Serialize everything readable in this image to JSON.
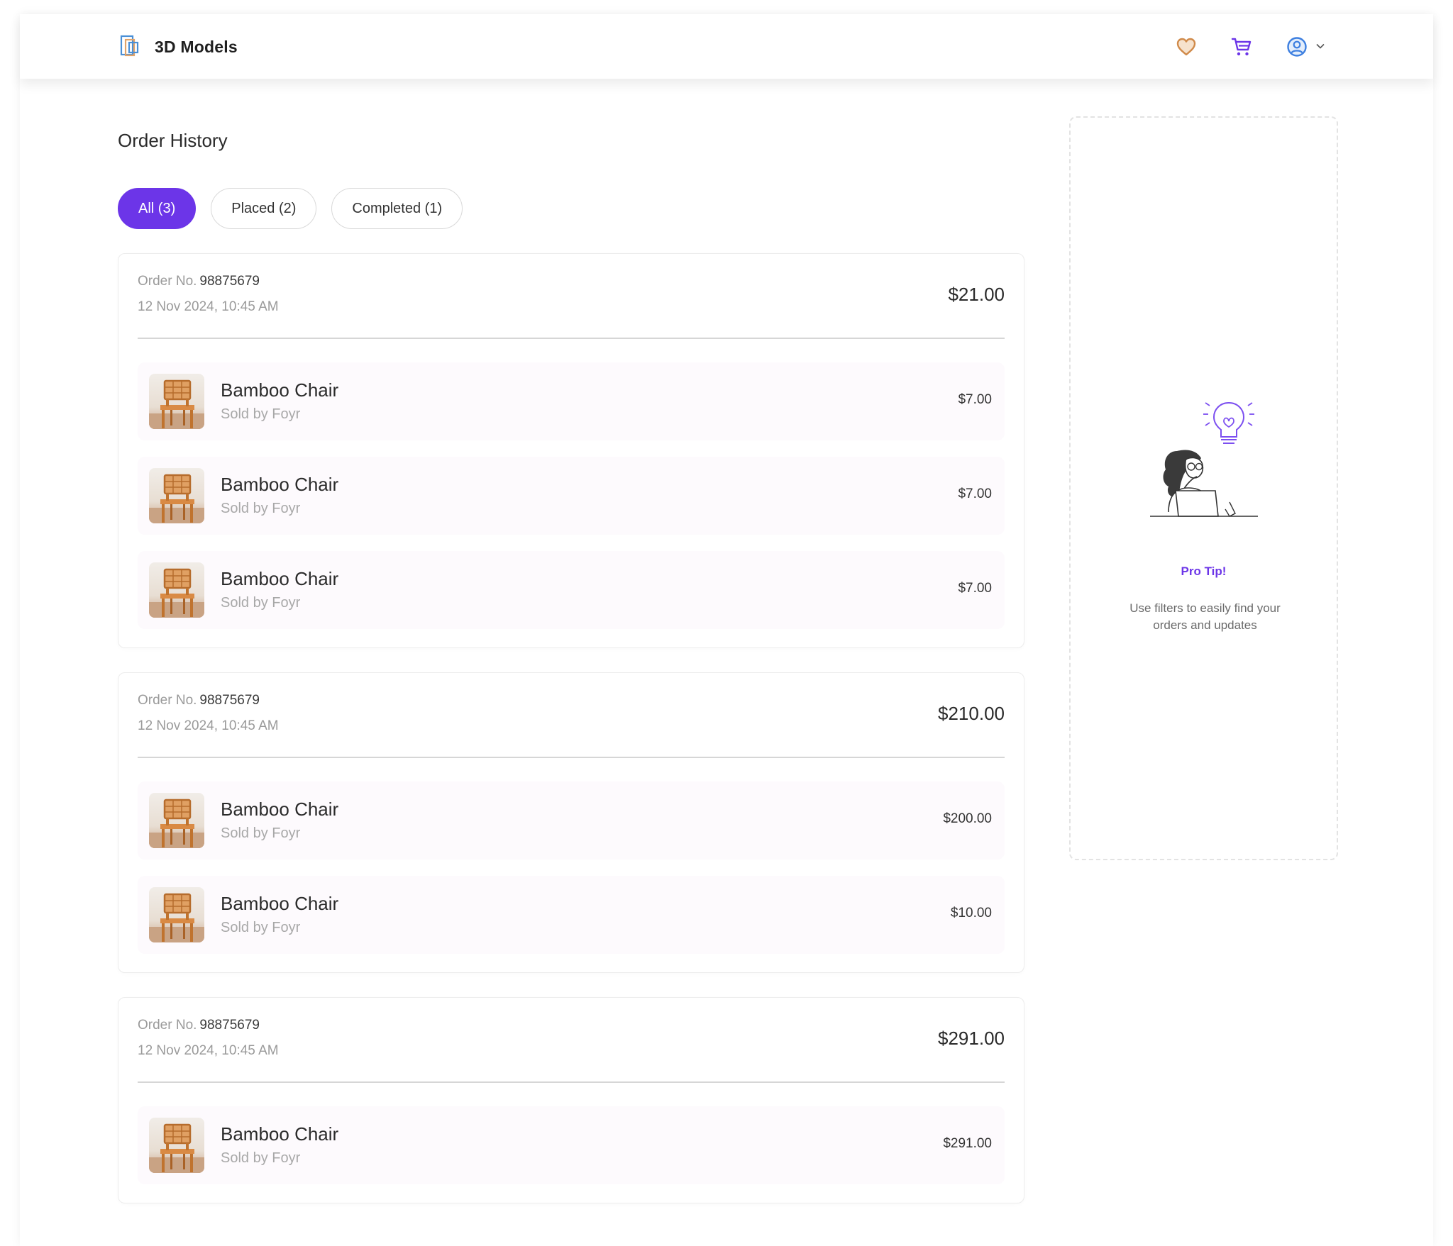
{
  "header": {
    "brand_title": "3D Models",
    "icons": [
      "logo-icon",
      "heart-icon",
      "cart-icon",
      "user-icon",
      "chevron-down-icon"
    ],
    "colors": {
      "heart": "#d08a4a",
      "cart": "#6c35e8",
      "user": "#3d7fe0",
      "accent": "#6c35e8"
    }
  },
  "main": {
    "title": "Order History",
    "filters": [
      {
        "label": "All (3)",
        "active": true
      },
      {
        "label": "Placed (2)",
        "active": false
      },
      {
        "label": "Completed (1)",
        "active": false
      }
    ],
    "orders": [
      {
        "order_no_label": "Order No.",
        "order_no": "98875679",
        "date": "12 Nov 2024, 10:45 AM",
        "total": "$21.00",
        "items": [
          {
            "name": "Bamboo Chair",
            "seller": "Sold by Foyr",
            "price": "$7.00"
          },
          {
            "name": "Bamboo Chair",
            "seller": "Sold by Foyr",
            "price": "$7.00"
          },
          {
            "name": "Bamboo Chair",
            "seller": "Sold by Foyr",
            "price": "$7.00"
          }
        ]
      },
      {
        "order_no_label": "Order No.",
        "order_no": "98875679",
        "date": "12 Nov 2024, 10:45 AM",
        "total": "$210.00",
        "items": [
          {
            "name": "Bamboo Chair",
            "seller": "Sold by Foyr",
            "price": "$200.00"
          },
          {
            "name": "Bamboo Chair",
            "seller": "Sold by Foyr",
            "price": "$10.00"
          }
        ]
      },
      {
        "order_no_label": "Order No.",
        "order_no": "98875679",
        "date": "12 Nov 2024, 10:45 AM",
        "total": "$291.00",
        "items": [
          {
            "name": "Bamboo Chair",
            "seller": "Sold by Foyr",
            "price": "$291.00"
          }
        ]
      }
    ]
  },
  "tip": {
    "title": "Pro Tip!",
    "text": "Use filters to easily find your orders and updates"
  }
}
